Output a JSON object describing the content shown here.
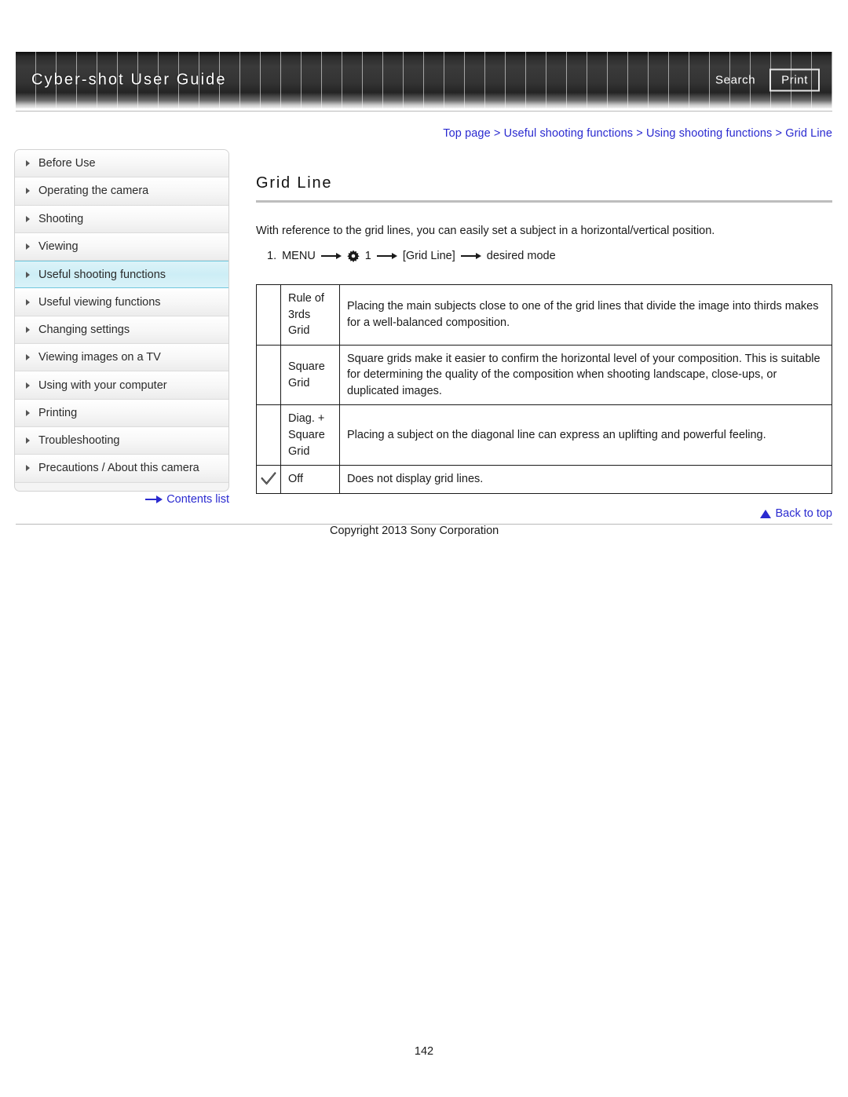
{
  "header": {
    "title": "Cyber-shot User Guide",
    "search_label": "Search",
    "print_label": "Print"
  },
  "breadcrumb": {
    "full": "Top page > Useful shooting functions > Using shooting functions > Grid Line",
    "items": [
      "Top page",
      "Useful shooting functions",
      "Using shooting functions",
      "Grid Line"
    ],
    "separator": ">",
    "link_color": "#2a2ad0"
  },
  "sidebar": {
    "items": [
      {
        "label": "Before Use",
        "active": false
      },
      {
        "label": "Operating the camera",
        "active": false
      },
      {
        "label": "Shooting",
        "active": false
      },
      {
        "label": "Viewing",
        "active": false
      },
      {
        "label": "Useful shooting functions",
        "active": true
      },
      {
        "label": "Useful viewing functions",
        "active": false
      },
      {
        "label": "Changing settings",
        "active": false
      },
      {
        "label": "Viewing images on a TV",
        "active": false
      },
      {
        "label": "Using with your computer",
        "active": false
      },
      {
        "label": "Printing",
        "active": false
      },
      {
        "label": "Troubleshooting",
        "active": false
      },
      {
        "label": "Precautions / About this camera",
        "active": false
      }
    ],
    "active_highlight_color": "#cdeef6",
    "contents_list_label": "Contents list"
  },
  "main": {
    "title": "Grid Line",
    "intro": "With reference to the grid lines, you can easily set a subject in a horizontal/vertical position.",
    "step": {
      "number": "1.",
      "menu_label": "MENU",
      "gear_number": "1",
      "bracket_item": "[Grid Line]",
      "tail": "desired mode"
    },
    "table": {
      "rows": [
        {
          "checked": false,
          "name": "Rule of 3rds Grid",
          "description": "Placing the main subjects close to one of the grid lines that divide the image into thirds makes for a well-balanced composition."
        },
        {
          "checked": false,
          "name": "Square Grid",
          "description": "Square grids make it easier to confirm the horizontal level of your composition. This is suitable for determining the quality of the composition when shooting landscape, close-ups, or duplicated images."
        },
        {
          "checked": false,
          "name": "Diag. + Square Grid",
          "description": "Placing a subject on the diagonal line can express an uplifting and powerful feeling."
        },
        {
          "checked": true,
          "name": "Off",
          "description": "Does not display grid lines."
        }
      ]
    }
  },
  "footer": {
    "back_to_top_label": "Back to top",
    "copyright": "Copyright 2013 Sony Corporation",
    "page_number": "142"
  }
}
